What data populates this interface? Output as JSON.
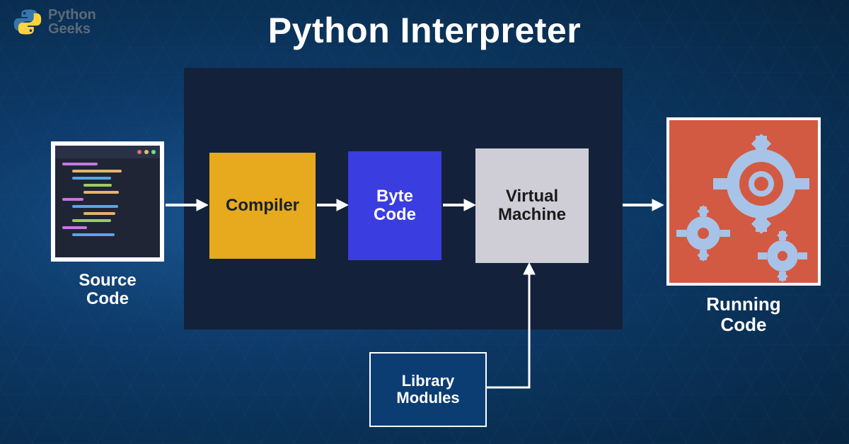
{
  "brand": {
    "line1": "Python",
    "line2": "Geeks"
  },
  "title": "Python Interpreter",
  "nodes": {
    "source": "Source\nCode",
    "compiler": "Compiler",
    "bytecode": "Byte\nCode",
    "vm": "Virtual\nMachine",
    "library": "Library\nModules",
    "running": "Running\nCode"
  },
  "colors": {
    "compiler": "#e7a91e",
    "bytecode": "#3a3de0",
    "vm": "#cfcdd6",
    "library": "#0b3d73",
    "running": "#d35a42",
    "interp_bg": "#13223a"
  },
  "flow": [
    {
      "from": "source",
      "to": "compiler"
    },
    {
      "from": "compiler",
      "to": "bytecode"
    },
    {
      "from": "bytecode",
      "to": "vm"
    },
    {
      "from": "vm",
      "to": "running"
    },
    {
      "from": "library",
      "to": "vm"
    }
  ]
}
